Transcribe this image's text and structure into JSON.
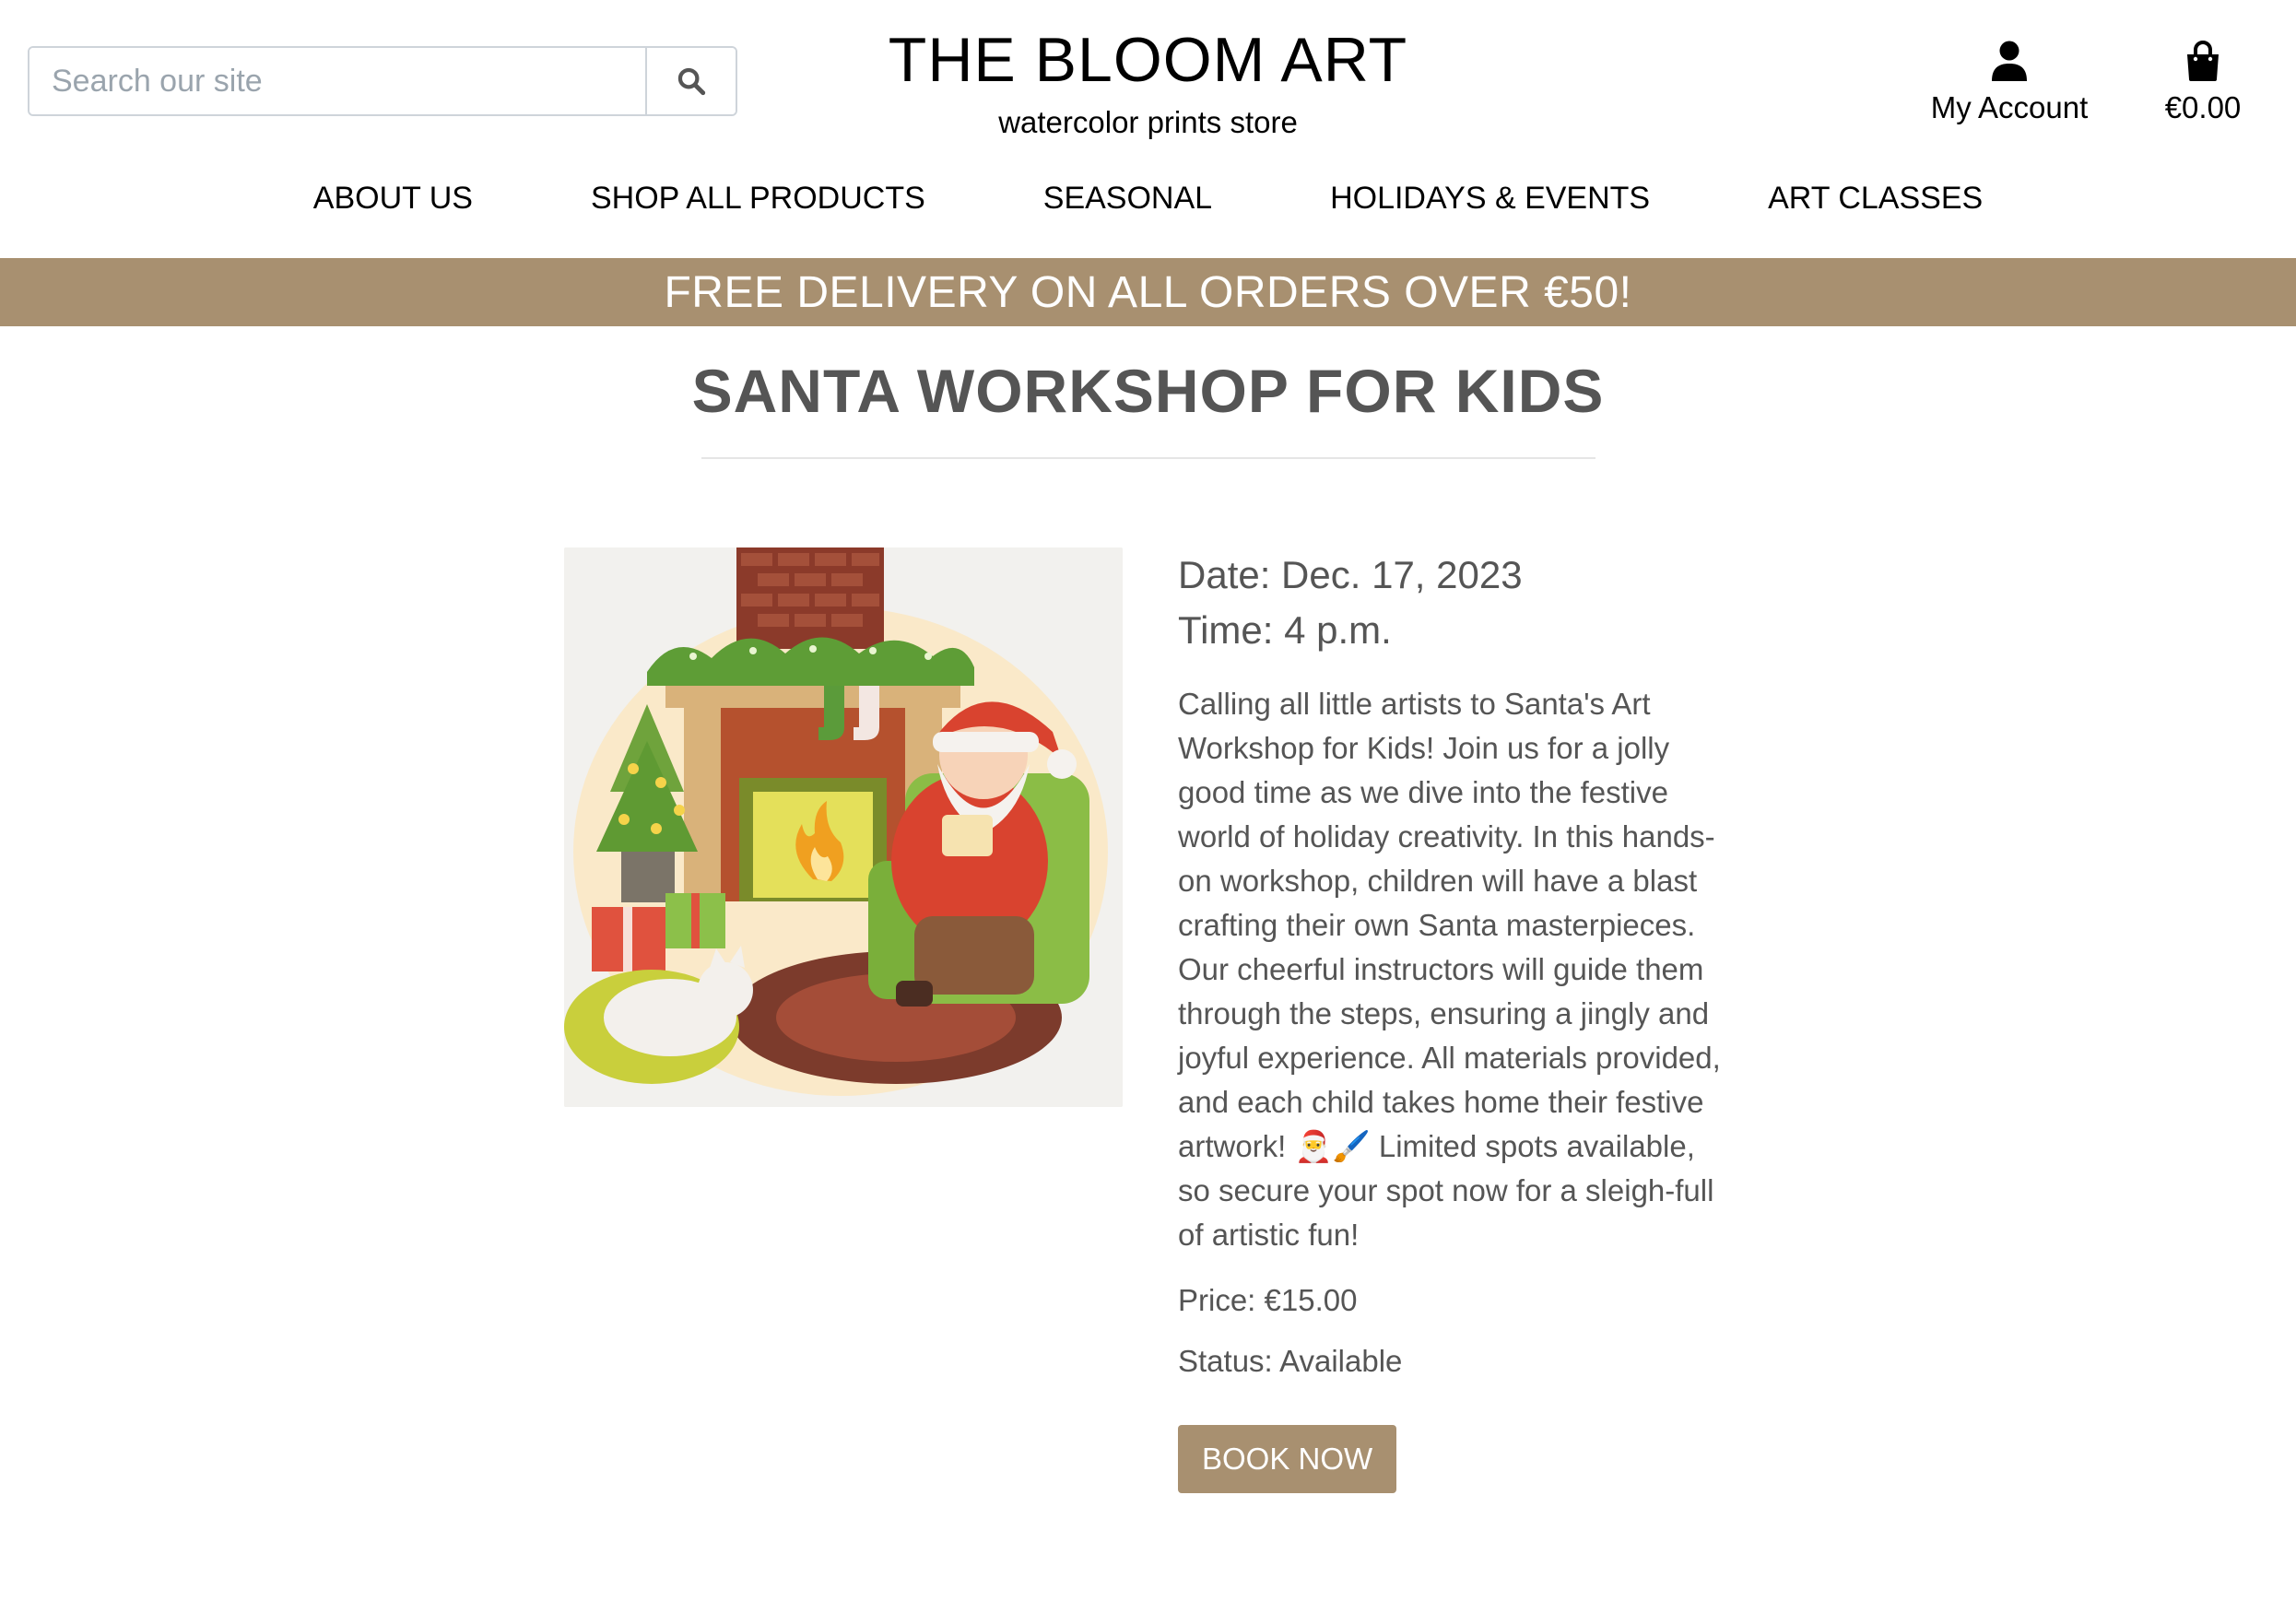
{
  "search": {
    "placeholder": "Search our site",
    "icon": "search-icon"
  },
  "brand": {
    "title": "THE BLOOM ART",
    "subtitle": "watercolor prints store"
  },
  "account": {
    "label": "My Account",
    "icon": "user-icon"
  },
  "cart": {
    "total": "€0.00",
    "icon": "shopping-bag-icon"
  },
  "nav": {
    "items": [
      {
        "label": "ABOUT US"
      },
      {
        "label": "SHOP ALL PRODUCTS"
      },
      {
        "label": "SEASONAL"
      },
      {
        "label": "HOLIDAYS & EVENTS"
      },
      {
        "label": "ART CLASSES"
      }
    ]
  },
  "banner": {
    "text": "FREE DELIVERY ON ALL ORDERS OVER €50!"
  },
  "workshop": {
    "title": "SANTA WORKSHOP FOR KIDS",
    "image_alt": "Watercolor illustration of Santa reading by the fireplace",
    "date": "Date: Dec. 17, 2023",
    "time": "Time: 4 p.m.",
    "description": "Calling all little artists to Santa's Art Workshop for Kids! Join us for a jolly good time as we dive into the festive world of holiday creativity. In this hands-on workshop, children will have a blast crafting their own Santa masterpieces. Our cheerful instructors will guide them through the steps, ensuring a jingly and joyful experience. All materials provided, and each child takes home their festive artwork! 🎅🖌️ Limited spots available, so secure your spot now for a sleigh-full of artistic fun!",
    "price": "Price: €15.00",
    "status": "Status: Available",
    "book_label": "BOOK NOW"
  },
  "colors": {
    "accent": "#a89070",
    "text": "#555555"
  }
}
